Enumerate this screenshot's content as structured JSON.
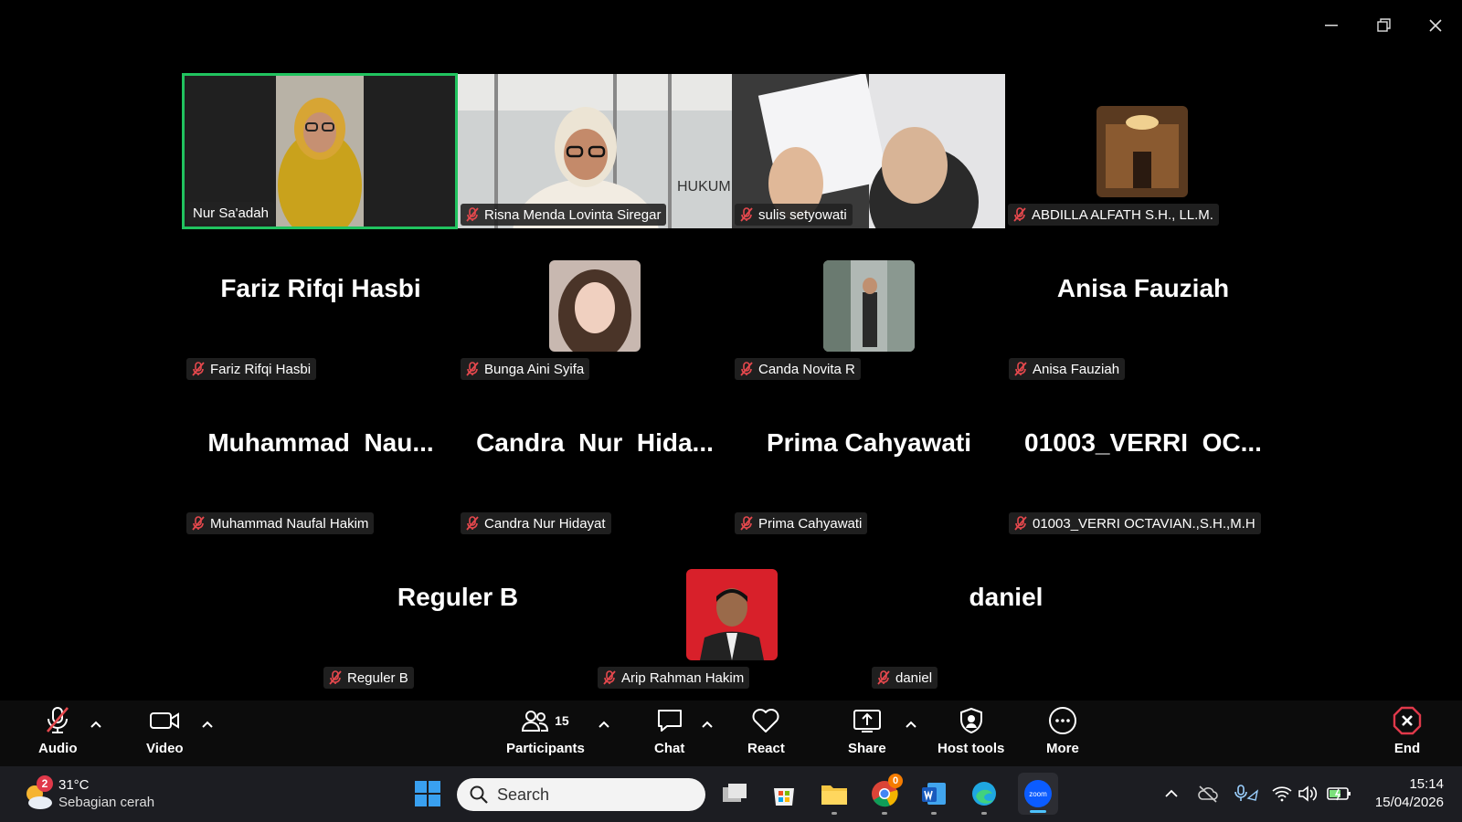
{
  "window": {
    "minimize_icon": "minimize-icon",
    "restore_icon": "restore-icon",
    "close_icon": "close-icon"
  },
  "colors": {
    "active_speaker_border": "#21c35f",
    "muted_icon": "#e5484d",
    "end_button": "#e0394a",
    "zoom_blue": "#0b5cff"
  },
  "participants": {
    "video_tiles": [
      {
        "name": "Nur Sa'adah",
        "muted": false,
        "active": true
      },
      {
        "name": "Risna Menda Lovinta Siregar",
        "muted": true
      },
      {
        "name": "sulis setyowati",
        "muted": true
      },
      {
        "name": "ABDILLA ALFATH S.H., LL.M.",
        "muted": true
      }
    ],
    "row2": [
      {
        "display": "Fariz Rifqi Hasbi",
        "name": "Fariz Rifqi Hasbi"
      },
      {
        "display": "",
        "name": "Bunga Aini Syifa"
      },
      {
        "display": "",
        "name": "Canda Novita R"
      },
      {
        "display": "Anisa Fauziah",
        "name": "Anisa Fauziah"
      }
    ],
    "row3": [
      {
        "display": "Muhammad  Nau...",
        "name": "Muhammad Naufal Hakim"
      },
      {
        "display": "Candra  Nur  Hida...",
        "name": "Candra Nur Hidayat"
      },
      {
        "display": "Prima Cahyawati",
        "name": "Prima Cahyawati"
      },
      {
        "display": "01003_VERRI  OC...",
        "name": "01003_VERRI OCTAVIAN.,S.H.,M.H"
      }
    ],
    "row4": [
      {
        "display": "Reguler B",
        "name": "Reguler B"
      },
      {
        "display": "",
        "name": "Arip Rahman Hakim"
      },
      {
        "display": "daniel",
        "name": "daniel"
      }
    ]
  },
  "toolbar": {
    "audio": "Audio",
    "video": "Video",
    "participants": "Participants",
    "participants_count": "15",
    "chat": "Chat",
    "react": "React",
    "share": "Share",
    "host_tools": "Host tools",
    "more": "More",
    "end": "End"
  },
  "taskbar": {
    "weather_temp": "31°C",
    "weather_desc": "Sebagian cerah",
    "weather_badge": "2",
    "search_placeholder": "Search",
    "chrome_badge": "0",
    "time": "15:14",
    "date": "15/04/2026"
  }
}
